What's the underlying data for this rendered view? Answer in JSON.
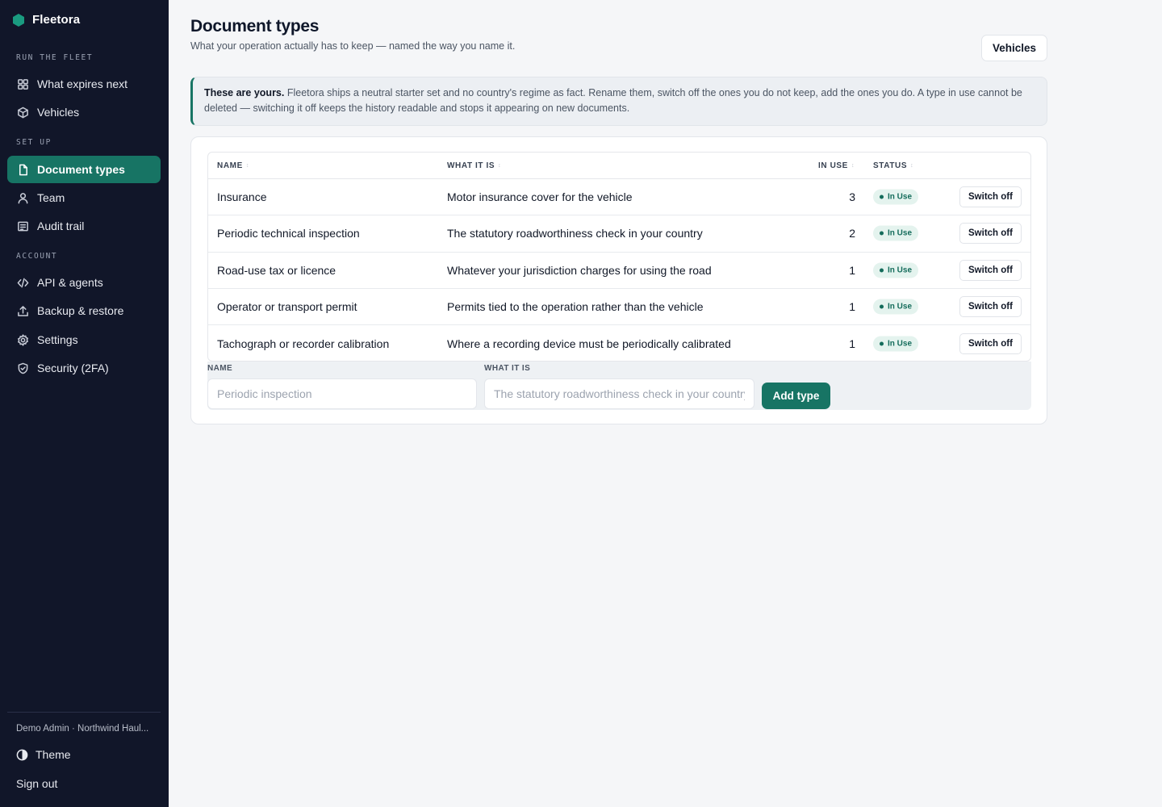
{
  "app": {
    "name": "Fleetora",
    "brand_color": "#177464"
  },
  "sidebar": {
    "sections": [
      {
        "label": "RUN THE FLEET",
        "items": [
          {
            "label": "What expires next",
            "icon": "dashboard-icon"
          },
          {
            "label": "Vehicles",
            "icon": "box-icon"
          }
        ]
      },
      {
        "label": "SET UP",
        "items": [
          {
            "label": "Document types",
            "icon": "document-icon",
            "active": true
          },
          {
            "label": "Team",
            "icon": "user-icon"
          },
          {
            "label": "Audit trail",
            "icon": "list-icon"
          }
        ]
      },
      {
        "label": "ACCOUNT",
        "items": [
          {
            "label": "API & agents",
            "icon": "code-icon"
          },
          {
            "label": "Backup & restore",
            "icon": "upload-icon"
          },
          {
            "label": "Settings",
            "icon": "gear-icon"
          },
          {
            "label": "Security (2FA)",
            "icon": "shield-icon"
          }
        ]
      }
    ],
    "user": "Demo Admin · Northwind Haul...",
    "theme_label": "Theme",
    "signout_label": "Sign out"
  },
  "header": {
    "title": "Document types",
    "subtitle": "What your operation actually has to keep — named the way you name it.",
    "vehicles_button": "Vehicles"
  },
  "notice": {
    "bold": "These are yours.",
    "text": " Fleetora ships a neutral starter set and no country's regime as fact. Rename them, switch off the ones you do not keep, add the ones you do. A type in use cannot be deleted — switching it off keeps the history readable and stops it appearing on new documents."
  },
  "table": {
    "columns": {
      "name": "NAME",
      "what": "WHAT IT IS",
      "in_use": "IN USE",
      "status": "STATUS"
    },
    "rows": [
      {
        "name": "Insurance",
        "what": "Motor insurance cover for the vehicle",
        "in_use": "3",
        "status": "In Use",
        "action": "Switch off"
      },
      {
        "name": "Periodic technical inspection",
        "what": "The statutory roadworthiness check in your country",
        "in_use": "2",
        "status": "In Use",
        "action": "Switch off"
      },
      {
        "name": "Road-use tax or licence",
        "what": "Whatever your jurisdiction charges for using the road",
        "in_use": "1",
        "status": "In Use",
        "action": "Switch off"
      },
      {
        "name": "Operator or transport permit",
        "what": "Permits tied to the operation rather than the vehicle",
        "in_use": "1",
        "status": "In Use",
        "action": "Switch off"
      },
      {
        "name": "Tachograph or recorder calibration",
        "what": "Where a recording device must be periodically calibrated",
        "in_use": "1",
        "status": "In Use",
        "action": "Switch off"
      }
    ]
  },
  "add_form": {
    "name_label": "NAME",
    "name_placeholder": "Periodic inspection",
    "what_label": "WHAT IT IS",
    "what_placeholder": "The statutory roadworthiness check in your country",
    "button": "Add type"
  }
}
